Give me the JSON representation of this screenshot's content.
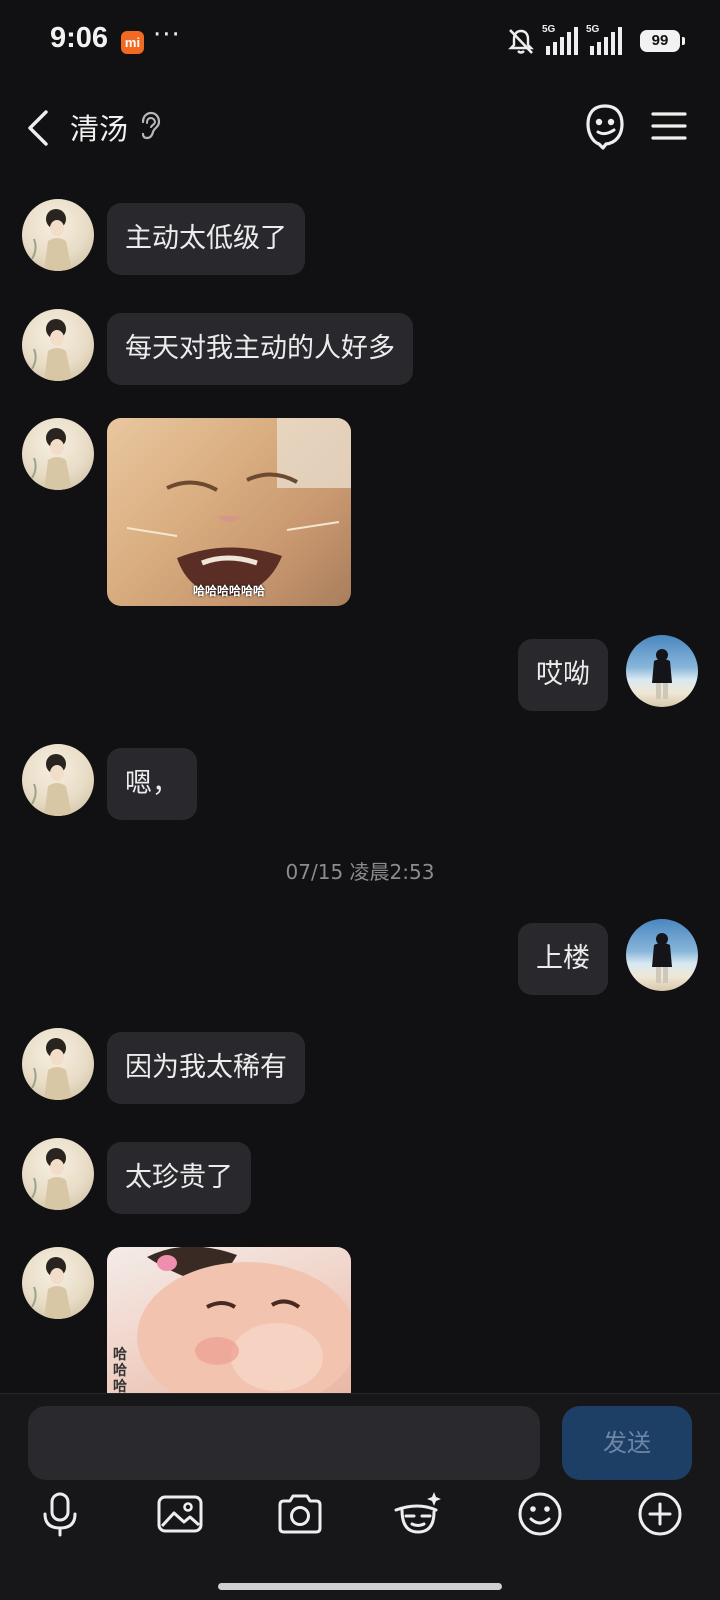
{
  "status_bar": {
    "time": "9:06",
    "mi_badge": "mi",
    "dots": "···",
    "network_1": "5G",
    "network_2": "5G",
    "battery": "99",
    "icons": [
      "mi-icon",
      "bell-off-icon",
      "signal-icon",
      "signal-icon",
      "battery-icon"
    ]
  },
  "header": {
    "title": "清汤",
    "icons": [
      "back-arrow-icon",
      "ear-icon",
      "bot-icon",
      "menu-icon"
    ]
  },
  "messages": [
    {
      "side": "left",
      "type": "text",
      "text": "主动太低级了"
    },
    {
      "side": "left",
      "type": "text",
      "text": "每天对我主动的人好多"
    },
    {
      "side": "left",
      "type": "image",
      "caption": "哈哈哈哈哈哈",
      "description": "laughing cat sticker"
    },
    {
      "side": "right",
      "type": "text",
      "text": "哎呦"
    },
    {
      "side": "left",
      "type": "text",
      "text": "嗯，"
    },
    {
      "type": "timestamp",
      "text": "07/15 凌晨2:53"
    },
    {
      "side": "right",
      "type": "text",
      "text": "上楼"
    },
    {
      "side": "left",
      "type": "text",
      "text": "因为我太稀有"
    },
    {
      "side": "left",
      "type": "text",
      "text": "太珍贵了"
    },
    {
      "side": "left",
      "type": "image",
      "caption": "哈哈哈",
      "description": "laughing child sticker"
    }
  ],
  "input": {
    "placeholder": "",
    "send_label": "发送",
    "toolbar_icons": [
      "microphone-icon",
      "image-icon",
      "camera-icon",
      "sticker-icon",
      "emoji-icon",
      "plus-icon"
    ]
  },
  "colors": {
    "background": "#111114",
    "bubble": "#29292d",
    "send_button": "#1d3f66",
    "mi_orange": "#f26a21"
  }
}
